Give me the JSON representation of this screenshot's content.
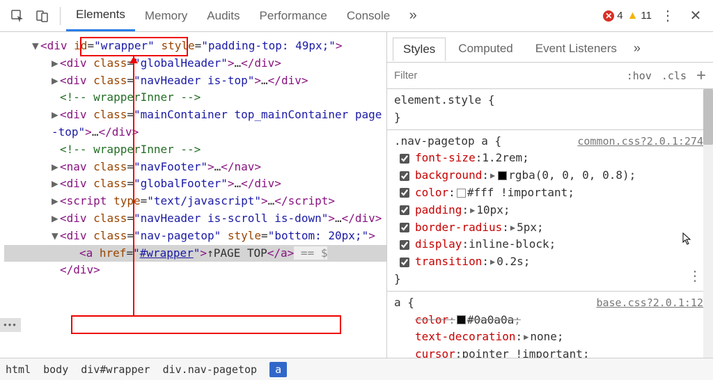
{
  "toolbar": {
    "tabs": [
      "Elements",
      "Memory",
      "Audits",
      "Performance",
      "Console"
    ],
    "active_tab": 0,
    "errors": "4",
    "warnings": "11"
  },
  "dom_lines": [
    {
      "indent": 0,
      "caret": "▼",
      "parts": [
        {
          "t": "tag",
          "s": "<div "
        },
        {
          "t": "attr",
          "s": "id"
        },
        {
          "t": "pun",
          "s": "="
        },
        {
          "t": "quote",
          "s": "\""
        },
        {
          "t": "val",
          "s": "wrapper"
        },
        {
          "t": "quote",
          "s": "\""
        },
        {
          "t": "pun",
          "s": " "
        },
        {
          "t": "attr",
          "s": "style"
        },
        {
          "t": "pun",
          "s": "="
        },
        {
          "t": "quote",
          "s": "\""
        },
        {
          "t": "val",
          "s": "padding-top: 49px;"
        },
        {
          "t": "quote",
          "s": "\""
        },
        {
          "t": "tag",
          "s": ">"
        }
      ]
    },
    {
      "indent": 1,
      "caret": "▶",
      "parts": [
        {
          "t": "tag",
          "s": "<div "
        },
        {
          "t": "attr",
          "s": "class"
        },
        {
          "t": "pun",
          "s": "="
        },
        {
          "t": "quote",
          "s": "\""
        },
        {
          "t": "val",
          "s": "globalHeader"
        },
        {
          "t": "quote",
          "s": "\""
        },
        {
          "t": "tag",
          "s": ">"
        },
        {
          "t": "txt",
          "s": "…"
        },
        {
          "t": "tag",
          "s": "</div>"
        }
      ]
    },
    {
      "indent": 1,
      "caret": "▶",
      "parts": [
        {
          "t": "tag",
          "s": "<div "
        },
        {
          "t": "attr",
          "s": "class"
        },
        {
          "t": "pun",
          "s": "="
        },
        {
          "t": "quote",
          "s": "\""
        },
        {
          "t": "val",
          "s": "navHeader is-top"
        },
        {
          "t": "quote",
          "s": "\""
        },
        {
          "t": "tag",
          "s": ">"
        },
        {
          "t": "txt",
          "s": "…"
        },
        {
          "t": "tag",
          "s": "</div>"
        }
      ]
    },
    {
      "indent": 1,
      "caret": "",
      "parts": [
        {
          "t": "cmt",
          "s": "<!-- wrapperInner -->"
        }
      ]
    },
    {
      "indent": 1,
      "caret": "▶",
      "parts": [
        {
          "t": "tag",
          "s": "<div "
        },
        {
          "t": "attr",
          "s": "class"
        },
        {
          "t": "pun",
          "s": "="
        },
        {
          "t": "quote",
          "s": "\""
        },
        {
          "t": "val",
          "s": "mainContainer top_mainContainer page-top"
        },
        {
          "t": "quote",
          "s": "\""
        },
        {
          "t": "tag",
          "s": ">"
        },
        {
          "t": "txt",
          "s": "…"
        },
        {
          "t": "tag",
          "s": "</div>"
        }
      ]
    },
    {
      "indent": 1,
      "caret": "",
      "parts": [
        {
          "t": "cmt",
          "s": "<!-- wrapperInner -->"
        }
      ]
    },
    {
      "indent": 1,
      "caret": "▶",
      "parts": [
        {
          "t": "tag",
          "s": "<nav "
        },
        {
          "t": "attr",
          "s": "class"
        },
        {
          "t": "pun",
          "s": "="
        },
        {
          "t": "quote",
          "s": "\""
        },
        {
          "t": "val",
          "s": "navFooter"
        },
        {
          "t": "quote",
          "s": "\""
        },
        {
          "t": "tag",
          "s": ">"
        },
        {
          "t": "txt",
          "s": "…"
        },
        {
          "t": "tag",
          "s": "</nav>"
        }
      ]
    },
    {
      "indent": 1,
      "caret": "▶",
      "parts": [
        {
          "t": "tag",
          "s": "<div "
        },
        {
          "t": "attr",
          "s": "class"
        },
        {
          "t": "pun",
          "s": "="
        },
        {
          "t": "quote",
          "s": "\""
        },
        {
          "t": "val",
          "s": "globalFooter"
        },
        {
          "t": "quote",
          "s": "\""
        },
        {
          "t": "tag",
          "s": ">"
        },
        {
          "t": "txt",
          "s": "…"
        },
        {
          "t": "tag",
          "s": "</div>"
        }
      ]
    },
    {
      "indent": 1,
      "caret": "▶",
      "parts": [
        {
          "t": "tag",
          "s": "<script "
        },
        {
          "t": "attr",
          "s": "type"
        },
        {
          "t": "pun",
          "s": "="
        },
        {
          "t": "quote",
          "s": "\""
        },
        {
          "t": "val",
          "s": "text/javascript"
        },
        {
          "t": "quote",
          "s": "\""
        },
        {
          "t": "tag",
          "s": ">"
        },
        {
          "t": "txt",
          "s": "…"
        },
        {
          "t": "tag",
          "s": "<​/script>"
        }
      ]
    },
    {
      "indent": 1,
      "caret": "▶",
      "parts": [
        {
          "t": "tag",
          "s": "<div "
        },
        {
          "t": "attr",
          "s": "class"
        },
        {
          "t": "pun",
          "s": "="
        },
        {
          "t": "quote",
          "s": "\""
        },
        {
          "t": "val",
          "s": "navHeader is-scroll is-down"
        },
        {
          "t": "quote",
          "s": "\""
        },
        {
          "t": "tag",
          "s": ">"
        },
        {
          "t": "txt",
          "s": "…"
        },
        {
          "t": "tag",
          "s": "</div>"
        }
      ]
    },
    {
      "indent": 1,
      "caret": "▼",
      "parts": [
        {
          "t": "tag",
          "s": "<div "
        },
        {
          "t": "attr",
          "s": "class"
        },
        {
          "t": "pun",
          "s": "="
        },
        {
          "t": "quote",
          "s": "\""
        },
        {
          "t": "val",
          "s": "nav-pagetop"
        },
        {
          "t": "quote",
          "s": "\""
        },
        {
          "t": "pun",
          "s": " "
        },
        {
          "t": "attr",
          "s": "style"
        },
        {
          "t": "pun",
          "s": "="
        },
        {
          "t": "quote",
          "s": "\""
        },
        {
          "t": "val",
          "s": "bottom: 20px;"
        },
        {
          "t": "quote",
          "s": "\""
        },
        {
          "t": "tag",
          "s": ">"
        }
      ]
    },
    {
      "indent": 2,
      "caret": "",
      "selected": true,
      "parts": [
        {
          "t": "tag",
          "s": "<a "
        },
        {
          "t": "attr",
          "s": "href"
        },
        {
          "t": "pun",
          "s": "="
        },
        {
          "t": "quote",
          "s": "\""
        },
        {
          "t": "link",
          "s": "#wrapper"
        },
        {
          "t": "quote",
          "s": "\""
        },
        {
          "t": "tag",
          "s": ">"
        },
        {
          "t": "txt",
          "s": "↑PAGE TOP"
        },
        {
          "t": "tag",
          "s": "</a>"
        }
      ],
      "eq": " == $"
    },
    {
      "indent": 1,
      "caret": "",
      "parts": [
        {
          "t": "tag",
          "s": "</div>"
        }
      ]
    }
  ],
  "crumb": [
    "html",
    "body",
    "div#wrapper",
    "div.nav-pagetop",
    "a"
  ],
  "crumb_sel": 4,
  "right_tabs": [
    "Styles",
    "Computed",
    "Event Listeners"
  ],
  "right_active": 0,
  "filter_placeholder": "Filter",
  "hov": ":hov",
  "cls": ".cls",
  "rules": [
    {
      "selector": "element.style",
      "brace_open": " {",
      "brace_close": "}",
      "source": "",
      "props": []
    },
    {
      "selector": ".nav-pagetop a",
      "brace_open": " {",
      "brace_close": "}",
      "source": "common.css?2.0.1:274",
      "props": [
        {
          "name": "font-size",
          "value": "1.2rem",
          "swatch": null,
          "tri": false
        },
        {
          "name": "background",
          "value": "rgba(0, 0, 0, 0.8)",
          "swatch": "#000000",
          "tri": true
        },
        {
          "name": "color",
          "value": "#fff !important",
          "swatch": "#ffffff",
          "tri": false
        },
        {
          "name": "padding",
          "value": "10px",
          "swatch": null,
          "tri": true
        },
        {
          "name": "border-radius",
          "value": "5px",
          "swatch": null,
          "tri": true
        },
        {
          "name": "display",
          "value": "inline-block",
          "swatch": null,
          "tri": false
        },
        {
          "name": "transition",
          "value": "0.2s",
          "swatch": null,
          "tri": true
        }
      ],
      "vdots": true
    },
    {
      "selector": "a",
      "brace_open": " {",
      "brace_close": "",
      "source": "base.css?2.0.1:12",
      "props": [
        {
          "name": "color",
          "value": "#0a0a0a",
          "swatch": "#0a0a0a",
          "strike": true,
          "nochk": true
        },
        {
          "name": "text-decoration",
          "value": "none",
          "tri": true,
          "nochk": true
        },
        {
          "name": "cursor",
          "value": "pointer !important",
          "nochk": true
        }
      ]
    }
  ]
}
